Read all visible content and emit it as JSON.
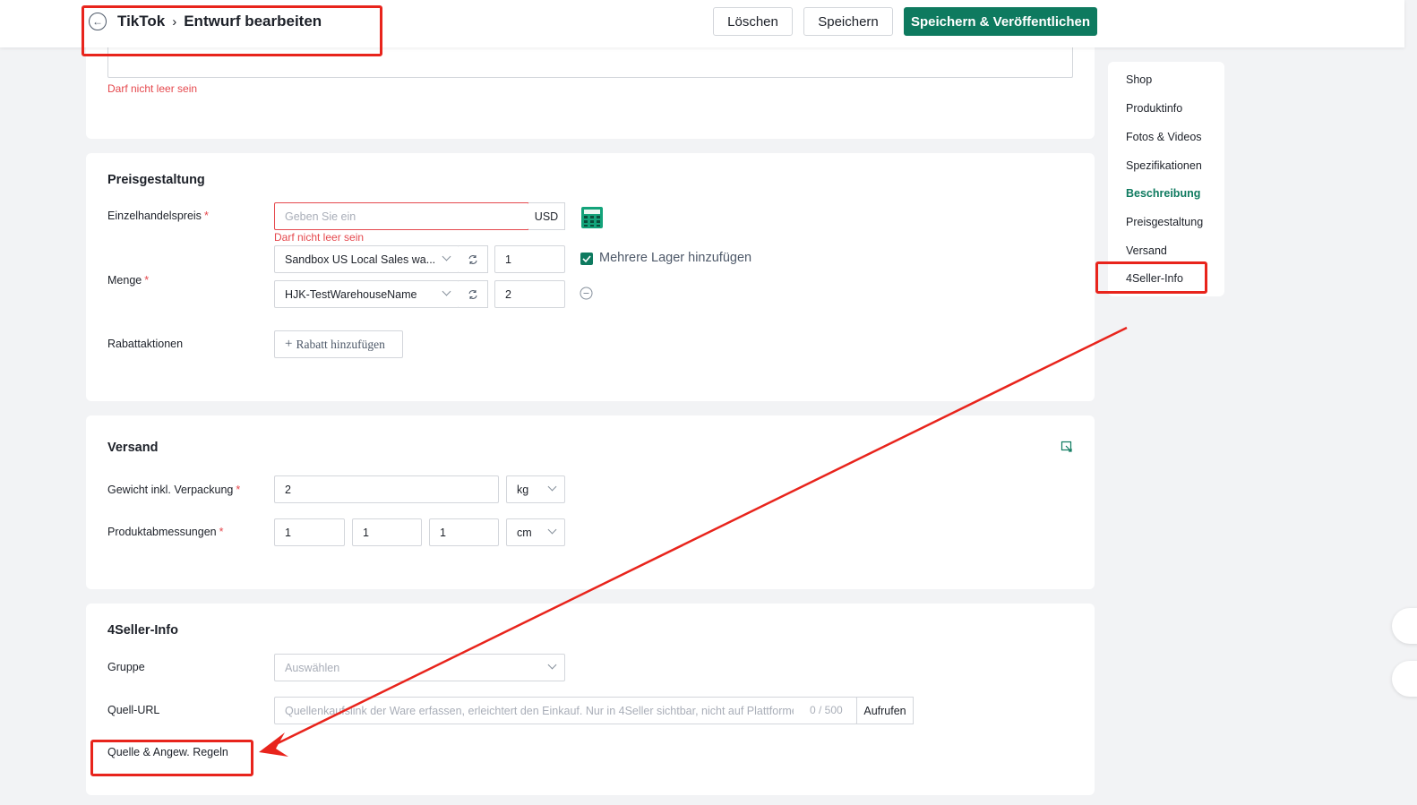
{
  "header": {
    "breadcrumb_root": "TikTok",
    "breadcrumb_current": "Entwurf bearbeiten",
    "delete_label": "Löschen",
    "save_label": "Speichern",
    "publish_label": "Speichern & Veröffentlichen"
  },
  "top_card": {
    "error": "Darf nicht leer sein"
  },
  "pricing": {
    "title": "Preisgestaltung",
    "retail_label": "Einzelhandelspreis",
    "retail_placeholder": "Geben Sie ein",
    "currency": "USD",
    "retail_error": "Darf nicht leer sein",
    "quantity_label": "Menge",
    "warehouses": [
      {
        "name": "Sandbox US Local Sales wa...",
        "qty": "1"
      },
      {
        "name": "HJK-TestWarehouseName",
        "qty": "2"
      }
    ],
    "multi_warehouse_label": "Mehrere Lager hinzufügen",
    "multi_warehouse_checked": true,
    "discount_label": "Rabattaktionen",
    "add_discount_label": "Rabatt hinzufügen"
  },
  "shipping": {
    "title": "Versand",
    "weight_label": "Gewicht inkl. Verpackung",
    "weight_value": "2",
    "weight_unit": "kg",
    "dimensions_label": "Produktabmessungen",
    "dimensions": [
      "1",
      "1",
      "1"
    ],
    "dimension_unit": "cm"
  },
  "seller_info": {
    "title": "4Seller-Info",
    "group_label": "Gruppe",
    "group_placeholder": "Auswählen",
    "source_url_label": "Quell-URL",
    "source_url_placeholder": "Quellenkaufslink der Ware erfassen, erleichtert den Einkauf. Nur in 4Seller sichtbar, nicht auf Plattformen",
    "source_url_count": "0 / 500",
    "open_label": "Aufrufen",
    "rules_label": "Quelle & Angew. Regeln",
    "rules_value": "-"
  },
  "sidenav": {
    "items": [
      {
        "label": "Shop"
      },
      {
        "label": "Produktinfo"
      },
      {
        "label": "Fotos & Videos"
      },
      {
        "label": "Spezifikationen"
      },
      {
        "label": "Beschreibung"
      },
      {
        "label": "Preisgestaltung"
      },
      {
        "label": "Versand"
      },
      {
        "label": "4Seller-Info"
      }
    ],
    "active_index": 4
  },
  "colors": {
    "primary": "#0e7a5f",
    "error": "#e5484d",
    "annotation": "#e8241c"
  },
  "icons": {
    "back": "arrow-left-icon",
    "separator": "chevron-right-icon",
    "refresh": "refresh-icon",
    "calculator": "calculator-icon",
    "remove": "minus-circle-icon",
    "plus": "plus-icon",
    "dropdown": "chevron-down-icon",
    "collapse": "collapse-icon"
  }
}
